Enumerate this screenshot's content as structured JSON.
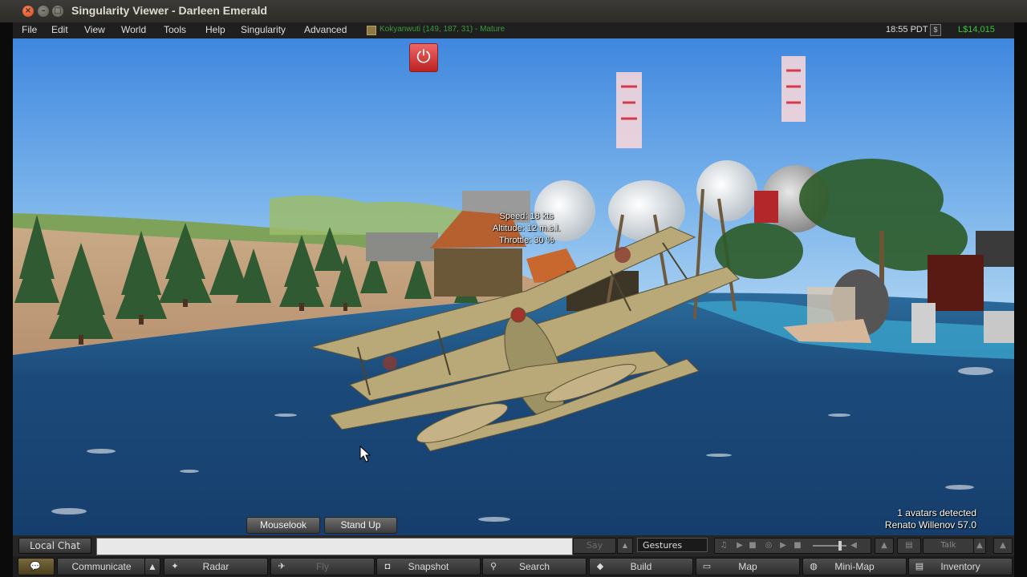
{
  "window": {
    "title": "Singularity Viewer - Darleen Emerald",
    "close_glyph": "×",
    "min_glyph": "–",
    "max_glyph": "□"
  },
  "menu": {
    "items": [
      "File",
      "Edit",
      "View",
      "World",
      "Tools",
      "Help",
      "Singularity",
      "Advanced"
    ],
    "parcel": "Kokyanwuti (149, 187, 31) - Mature",
    "time": "18:55 PDT",
    "money_icon": "$",
    "balance": "L$14,015"
  },
  "hud": {
    "speed": "Speed: 18 kts",
    "altitude": "Altitude: 12 m.s.l.",
    "throttle": "Throttle: 30 %",
    "power_glyph": "⏻"
  },
  "overlay": {
    "avatars_detected": "1 avatars detected",
    "avatar_name": "Renato Willenov 57.0"
  },
  "seat_buttons": {
    "mouselook": "Mouselook",
    "stand_up": "Stand Up"
  },
  "chat": {
    "local_chat": "Local Chat",
    "input_value": "",
    "say": "Say",
    "say_arrow": "▲",
    "gestures": "Gestures",
    "talk": "Talk",
    "up_arrow": "▲"
  },
  "toolbar": {
    "communicate": "Communicate",
    "communicate_arrow": "▲",
    "radar": "Radar",
    "fly": "Fly",
    "snapshot": "Snapshot",
    "search": "Search",
    "build": "Build",
    "map": "Map",
    "mini_map": "Mini-Map",
    "inventory": "Inventory"
  },
  "colors": {
    "balance_green": "#3ac53a",
    "parcel_green": "#3a9b3a",
    "power_red": "#cc3333"
  }
}
